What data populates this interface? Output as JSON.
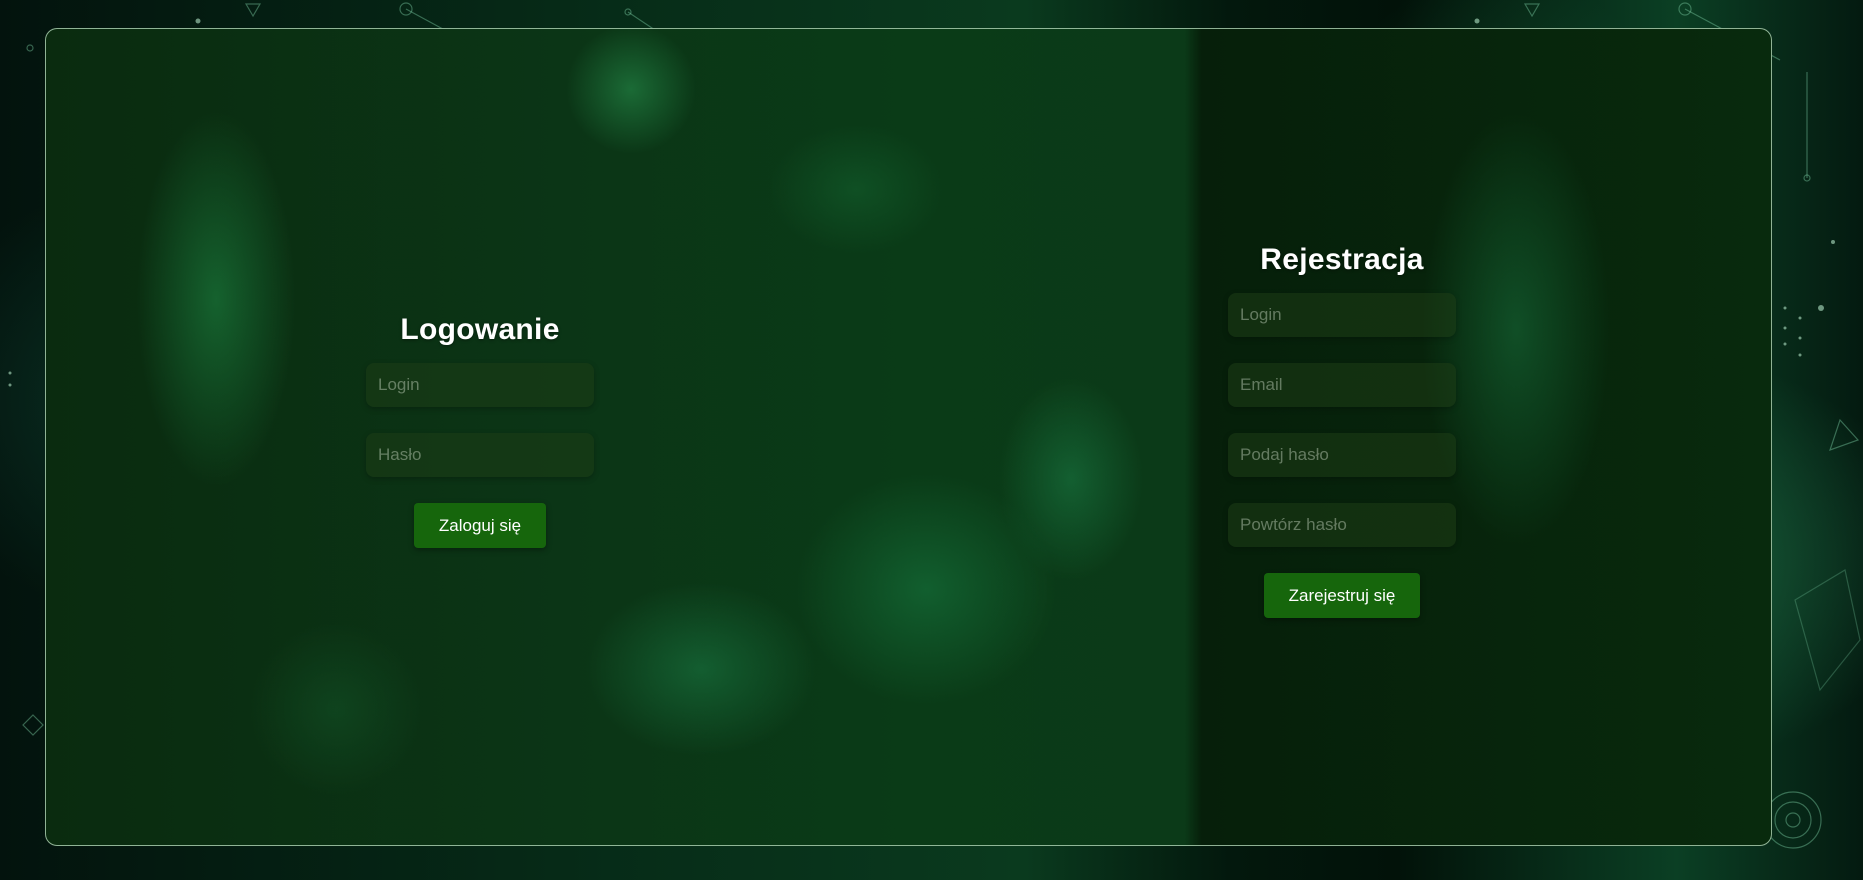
{
  "login": {
    "title": "Logowanie",
    "login_placeholder": "Login",
    "password_placeholder": "Hasło",
    "submit_label": "Zaloguj się"
  },
  "register": {
    "title": "Rejestracja",
    "login_placeholder": "Login",
    "email_placeholder": "Email",
    "password_placeholder": "Podaj hasło",
    "repeat_password_placeholder": "Powtórz hasło",
    "submit_label": "Zarejestruj się"
  },
  "colors": {
    "accent_button": "#16660c",
    "panel_border": "#bee1c3",
    "background": "#062a17"
  }
}
